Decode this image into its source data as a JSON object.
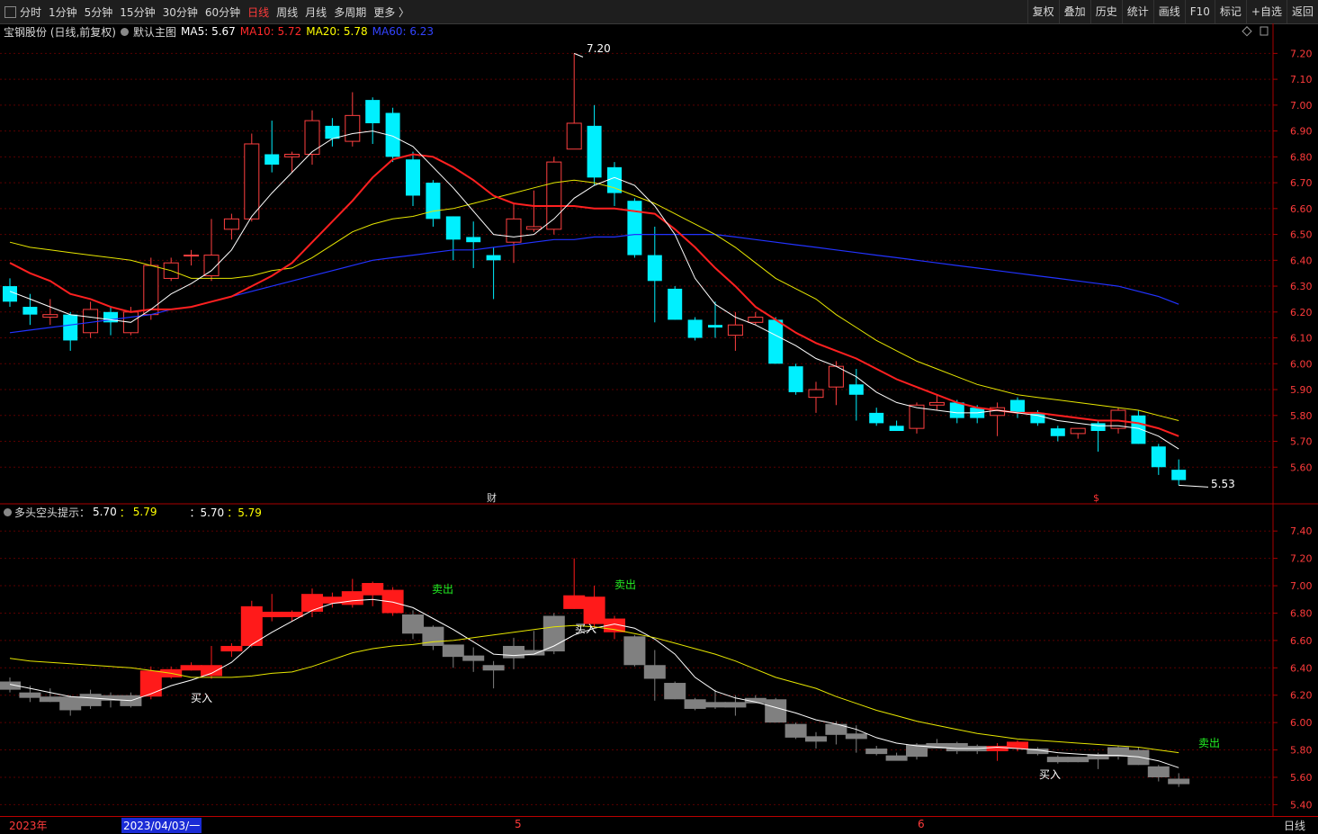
{
  "toolbar": {
    "period_tabs": [
      "分时",
      "1分钟",
      "5分钟",
      "15分钟",
      "30分钟",
      "60分钟",
      "日线",
      "周线",
      "月线",
      "多周期",
      "更多 〉"
    ],
    "active_tab": "日线",
    "tools": [
      "复权",
      "叠加",
      "历史",
      "统计",
      "画线",
      "F10",
      "标记",
      "+自选",
      "返回"
    ]
  },
  "main_info": {
    "stock": "宝钢股份 (日线,前复权)",
    "template": "默认主图",
    "ma5": "MA5: 5.67",
    "ma10": "MA10: 5.72",
    "ma20": "MA20: 5.78",
    "ma60": "MA60: 6.23",
    "colors": {
      "ma5": "#ffffff",
      "ma10": "#ff2a2a",
      "ma20": "#ffff00",
      "ma60": "#2233ff"
    }
  },
  "sub_info": {
    "name": "多头空头提示：",
    "v1": "5.70",
    "sep": "：",
    "v2": "5.79",
    "v3": "：5.70",
    "v4": "：5.79"
  },
  "main_axis": [
    "7.20",
    "7.10",
    "7.00",
    "6.90",
    "6.80",
    "6.70",
    "6.60",
    "6.50",
    "6.40",
    "6.30",
    "6.20",
    "6.10",
    "6.00",
    "5.90",
    "5.80",
    "5.70",
    "5.60"
  ],
  "sub_axis": [
    "7.40",
    "7.20",
    "7.00",
    "6.80",
    "6.60",
    "6.40",
    "6.20",
    "6.00",
    "5.80",
    "5.60",
    "5.40"
  ],
  "annotations": {
    "high_label": "7.20",
    "low_label": "5.53",
    "fin_marker": "财",
    "dollar_marker": "$",
    "buy": "买入",
    "sell": "卖出"
  },
  "bottom": {
    "year": "2023年",
    "date": "2023/04/03/一",
    "m5": "5",
    "m6": "6",
    "period": "日线"
  },
  "chart_data": {
    "type": "candlestick",
    "ohlc": [
      [
        6.3,
        6.33,
        6.22,
        6.24
      ],
      [
        6.22,
        6.27,
        6.15,
        6.19
      ],
      [
        6.18,
        6.25,
        6.15,
        6.19
      ],
      [
        6.19,
        6.2,
        6.05,
        6.09
      ],
      [
        6.12,
        6.24,
        6.1,
        6.21
      ],
      [
        6.2,
        6.22,
        6.11,
        6.16
      ],
      [
        6.12,
        6.22,
        6.11,
        6.2
      ],
      [
        6.19,
        6.41,
        6.17,
        6.38
      ],
      [
        6.33,
        6.41,
        6.32,
        6.39
      ],
      [
        6.42,
        6.44,
        6.38,
        6.42
      ],
      [
        6.34,
        6.56,
        6.32,
        6.42
      ],
      [
        6.52,
        6.58,
        6.48,
        6.56
      ],
      [
        6.56,
        6.89,
        6.55,
        6.85
      ],
      [
        6.81,
        6.94,
        6.74,
        6.77
      ],
      [
        6.8,
        6.82,
        6.74,
        6.81
      ],
      [
        6.81,
        6.98,
        6.77,
        6.94
      ],
      [
        6.92,
        6.95,
        6.84,
        6.87
      ],
      [
        6.86,
        7.05,
        6.84,
        6.96
      ],
      [
        7.02,
        7.03,
        6.85,
        6.93
      ],
      [
        6.97,
        6.99,
        6.78,
        6.8
      ],
      [
        6.79,
        6.82,
        6.61,
        6.65
      ],
      [
        6.7,
        6.71,
        6.53,
        6.56
      ],
      [
        6.57,
        6.57,
        6.4,
        6.48
      ],
      [
        6.49,
        6.55,
        6.37,
        6.47
      ],
      [
        6.42,
        6.45,
        6.25,
        6.4
      ],
      [
        6.47,
        6.62,
        6.39,
        6.56
      ],
      [
        6.52,
        6.67,
        6.51,
        6.53
      ],
      [
        6.52,
        6.8,
        6.5,
        6.78
      ],
      [
        6.83,
        7.2,
        6.83,
        6.93
      ],
      [
        6.92,
        7.0,
        6.69,
        6.72
      ],
      [
        6.76,
        6.78,
        6.61,
        6.66
      ],
      [
        6.63,
        6.64,
        6.41,
        6.42
      ],
      [
        6.42,
        6.53,
        6.16,
        6.32
      ],
      [
        6.29,
        6.3,
        6.17,
        6.17
      ],
      [
        6.17,
        6.18,
        6.09,
        6.1
      ],
      [
        6.15,
        6.24,
        6.1,
        6.14
      ],
      [
        6.11,
        6.2,
        6.05,
        6.15
      ],
      [
        6.16,
        6.2,
        6.15,
        6.18
      ],
      [
        6.17,
        6.18,
        6.0,
        6.0
      ],
      [
        5.99,
        6.0,
        5.88,
        5.89
      ],
      [
        5.87,
        5.93,
        5.81,
        5.9
      ],
      [
        5.91,
        6.01,
        5.84,
        5.99
      ],
      [
        5.92,
        5.98,
        5.78,
        5.88
      ],
      [
        5.81,
        5.83,
        5.76,
        5.77
      ],
      [
        5.76,
        5.78,
        5.74,
        5.74
      ],
      [
        5.75,
        5.85,
        5.73,
        5.84
      ],
      [
        5.84,
        5.88,
        5.82,
        5.85
      ],
      [
        5.85,
        5.86,
        5.77,
        5.79
      ],
      [
        5.83,
        5.84,
        5.77,
        5.79
      ],
      [
        5.8,
        5.85,
        5.72,
        5.83
      ],
      [
        5.86,
        5.87,
        5.79,
        5.81
      ],
      [
        5.81,
        5.82,
        5.76,
        5.77
      ],
      [
        5.75,
        5.76,
        5.7,
        5.72
      ],
      [
        5.73,
        5.75,
        5.71,
        5.75
      ],
      [
        5.77,
        5.78,
        5.66,
        5.74
      ],
      [
        5.75,
        5.83,
        5.73,
        5.82
      ],
      [
        5.8,
        5.82,
        5.69,
        5.69
      ],
      [
        5.68,
        5.69,
        5.57,
        5.6
      ],
      [
        5.59,
        5.63,
        5.53,
        5.55
      ]
    ],
    "ma5": [
      6.28,
      6.25,
      6.22,
      6.19,
      6.18,
      6.17,
      6.16,
      6.21,
      6.27,
      6.31,
      6.36,
      6.44,
      6.57,
      6.66,
      6.74,
      6.82,
      6.87,
      6.89,
      6.9,
      6.88,
      6.84,
      6.76,
      6.68,
      6.59,
      6.5,
      6.49,
      6.5,
      6.56,
      6.64,
      6.69,
      6.72,
      6.69,
      6.61,
      6.5,
      6.33,
      6.23,
      6.18,
      6.15,
      6.11,
      6.07,
      6.02,
      5.99,
      5.95,
      5.89,
      5.85,
      5.83,
      5.82,
      5.81,
      5.81,
      5.82,
      5.81,
      5.8,
      5.78,
      5.77,
      5.76,
      5.76,
      5.75,
      5.72,
      5.67
    ],
    "ma10": [
      6.39,
      6.35,
      6.32,
      6.27,
      6.25,
      6.22,
      6.2,
      6.21,
      6.21,
      6.22,
      6.24,
      6.26,
      6.3,
      6.34,
      6.39,
      6.47,
      6.55,
      6.63,
      6.72,
      6.79,
      6.81,
      6.8,
      6.76,
      6.71,
      6.65,
      6.62,
      6.61,
      6.61,
      6.61,
      6.6,
      6.6,
      6.59,
      6.58,
      6.52,
      6.45,
      6.37,
      6.3,
      6.22,
      6.17,
      6.12,
      6.08,
      6.05,
      6.02,
      5.98,
      5.94,
      5.91,
      5.88,
      5.85,
      5.83,
      5.82,
      5.81,
      5.81,
      5.8,
      5.79,
      5.78,
      5.78,
      5.77,
      5.75,
      5.72
    ],
    "ma20": [
      6.47,
      6.45,
      6.44,
      6.43,
      6.42,
      6.41,
      6.4,
      6.38,
      6.36,
      6.33,
      6.33,
      6.33,
      6.34,
      6.36,
      6.37,
      6.41,
      6.46,
      6.51,
      6.54,
      6.56,
      6.57,
      6.59,
      6.6,
      6.62,
      6.64,
      6.66,
      6.68,
      6.7,
      6.71,
      6.7,
      6.68,
      6.65,
      6.62,
      6.58,
      6.54,
      6.5,
      6.45,
      6.39,
      6.33,
      6.29,
      6.25,
      6.19,
      6.14,
      6.09,
      6.05,
      6.01,
      5.98,
      5.95,
      5.92,
      5.9,
      5.88,
      5.87,
      5.86,
      5.85,
      5.84,
      5.83,
      5.82,
      5.8,
      5.78
    ],
    "ma60": [
      6.12,
      6.13,
      6.14,
      6.15,
      6.16,
      6.17,
      6.18,
      6.19,
      6.21,
      6.22,
      6.24,
      6.26,
      6.28,
      6.3,
      6.32,
      6.34,
      6.36,
      6.38,
      6.4,
      6.41,
      6.42,
      6.43,
      6.44,
      6.44,
      6.45,
      6.46,
      6.47,
      6.48,
      6.48,
      6.49,
      6.49,
      6.5,
      6.5,
      6.5,
      6.5,
      6.5,
      6.49,
      6.48,
      6.47,
      6.46,
      6.45,
      6.44,
      6.43,
      6.42,
      6.41,
      6.4,
      6.39,
      6.38,
      6.37,
      6.36,
      6.35,
      6.34,
      6.33,
      6.32,
      6.31,
      6.3,
      6.28,
      6.26,
      6.23
    ],
    "ylim": [
      5.5,
      7.25
    ],
    "sub_ylim": [
      5.35,
      7.5
    ],
    "x_labels": [
      "2023年",
      "5",
      "6"
    ]
  }
}
